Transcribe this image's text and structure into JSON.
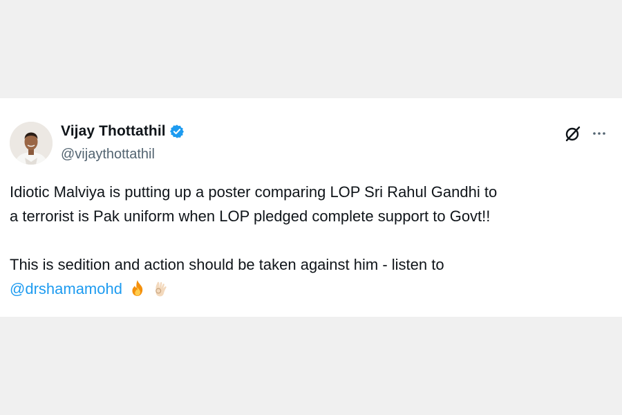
{
  "author": {
    "display_name": "Vijay Thottathil",
    "handle": "@vijaythottathil",
    "verified": true,
    "avatar_icon": "profile-photo"
  },
  "actions": {
    "grok_icon": "grok-icon",
    "more_icon": "more-options-icon"
  },
  "tweet": {
    "line1": "Idiotic Malviya is putting up a poster comparing LOP Sri Rahul Gandhi to",
    "line2": "a terrorist is Pak uniform when LOP pledged complete support to Govt!!",
    "line3": "This is sedition and action should be taken against him - listen to",
    "mention": "@drshamamohd",
    "emojis": [
      "fire",
      "ok-hand"
    ]
  },
  "colors": {
    "accent": "#1d9bf0",
    "text": "#0f1419",
    "secondary": "#536471"
  }
}
